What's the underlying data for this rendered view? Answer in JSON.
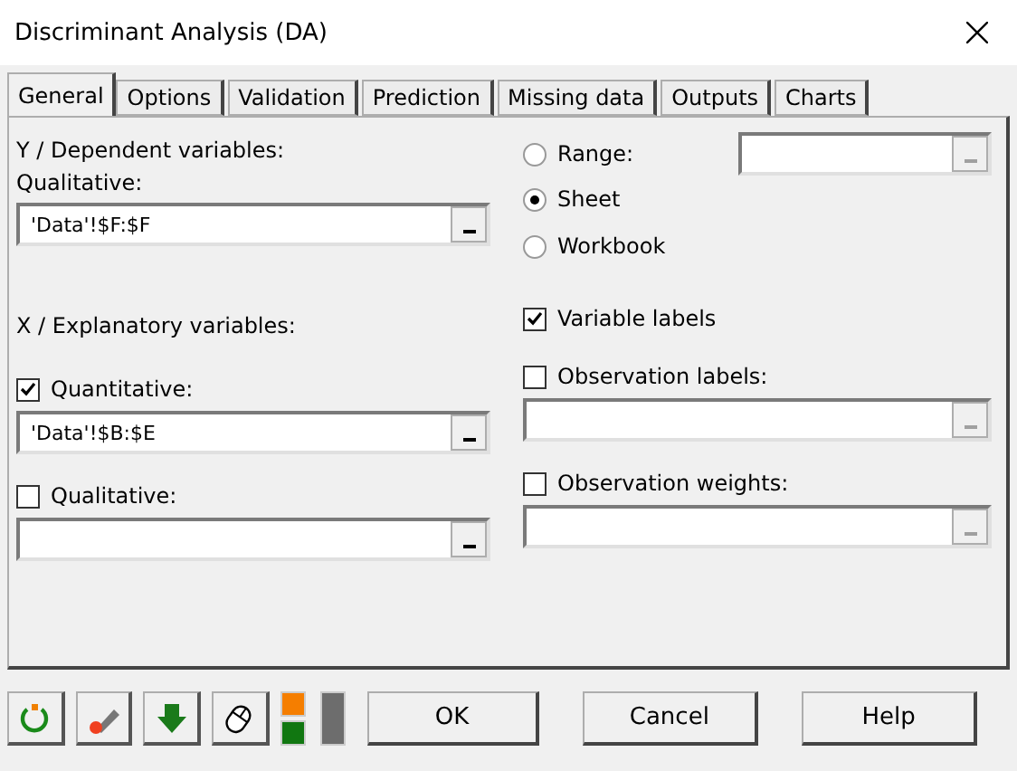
{
  "window": {
    "title": "Discriminant Analysis (DA)"
  },
  "tabs": [
    {
      "label": "General",
      "selected": true
    },
    {
      "label": "Options",
      "selected": false
    },
    {
      "label": "Validation",
      "selected": false
    },
    {
      "label": "Prediction",
      "selected": false
    },
    {
      "label": "Missing data",
      "selected": false
    },
    {
      "label": "Outputs",
      "selected": false
    },
    {
      "label": "Charts",
      "selected": false
    }
  ],
  "dependent": {
    "heading": "Y / Dependent variables:",
    "label": "Qualitative:",
    "field": {
      "value": "'Data'!$F:$F",
      "disabled": false
    }
  },
  "explanatory": {
    "heading": "X / Explanatory variables:",
    "items": [
      {
        "label": "Quantitative:",
        "checked": true,
        "field": {
          "value": "'Data'!$B:$E",
          "disabled": false
        }
      },
      {
        "label": "Qualitative:",
        "checked": false,
        "field": {
          "disabled": false
        }
      }
    ]
  },
  "scope": {
    "options": [
      {
        "label": "Range:",
        "selected": false
      },
      {
        "label": "Sheet",
        "selected": true
      },
      {
        "label": "Workbook",
        "selected": false
      }
    ],
    "range_field": {
      "disabled": true
    }
  },
  "variable_labels": {
    "label": "Variable labels",
    "checked": true
  },
  "observations": [
    {
      "label": "Observation labels:",
      "checked": false,
      "field": {
        "disabled": true
      }
    },
    {
      "label": "Observation weights:",
      "checked": false,
      "field": {
        "disabled": true
      }
    }
  ],
  "buttons": [
    "OK",
    "Cancel",
    "Help"
  ]
}
